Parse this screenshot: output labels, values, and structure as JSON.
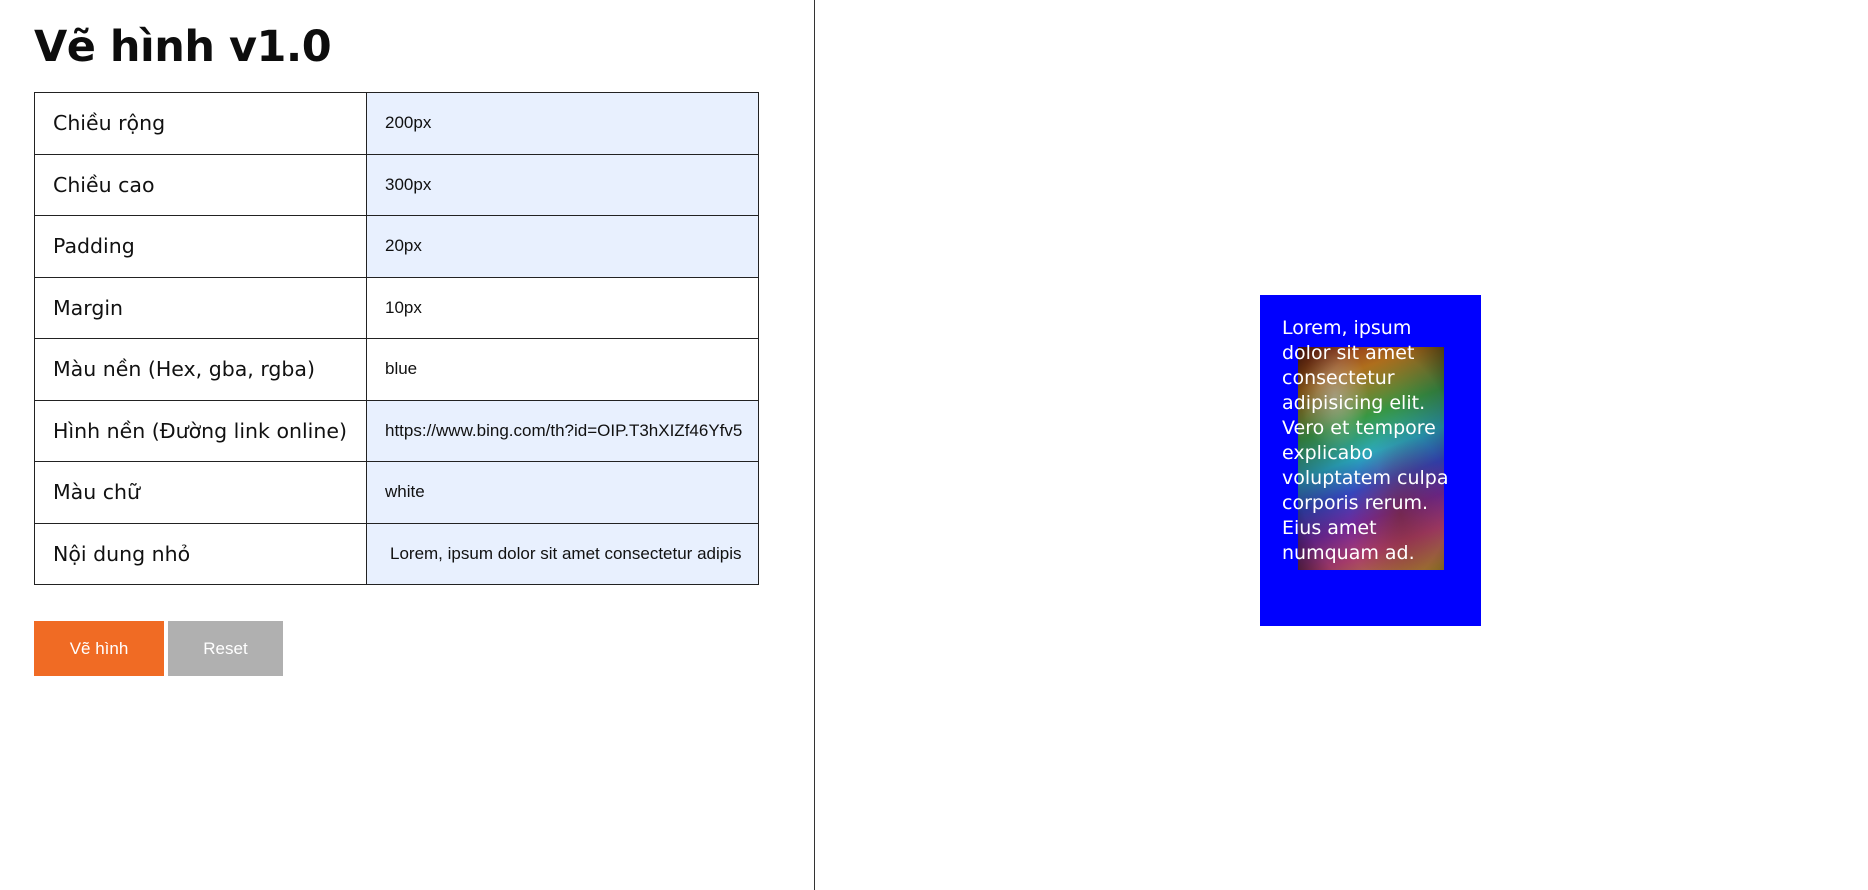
{
  "app": {
    "title": "Vẽ hình v1.0"
  },
  "form": {
    "rows": [
      {
        "label": "Chiều rộng",
        "value": "200px"
      },
      {
        "label": "Chiều cao",
        "value": "300px"
      },
      {
        "label": "Padding",
        "value": "20px"
      },
      {
        "label": "Margin",
        "value": "10px"
      },
      {
        "label": "Màu nền (Hex, gba, rgba)",
        "value": "blue"
      },
      {
        "label": "Hình nền (Đường link online)",
        "value": "https://www.bing.com/th?id=OIP.T3hXIZf46Yfv5"
      },
      {
        "label": "Màu chữ",
        "value": "white"
      },
      {
        "label": "Nội dung nhỏ",
        "value": "Lorem, ipsum dolor sit amet consectetur adipis"
      }
    ]
  },
  "buttons": {
    "draw_label": "Vẽ hình",
    "reset_label": "Reset"
  },
  "preview": {
    "background_color": "#0000ff",
    "text_color": "#ffffff",
    "text": "Lorem, ipsum dolor sit amet consectetur adipisicing elit. Vero et tempore explicabo voluptatem culpa corporis rerum. Eius amet numquam ad."
  },
  "colors": {
    "draw_button": "#f06b24",
    "reset_button": "#b0b0b0",
    "input_autofill": "#e8f0fe"
  }
}
